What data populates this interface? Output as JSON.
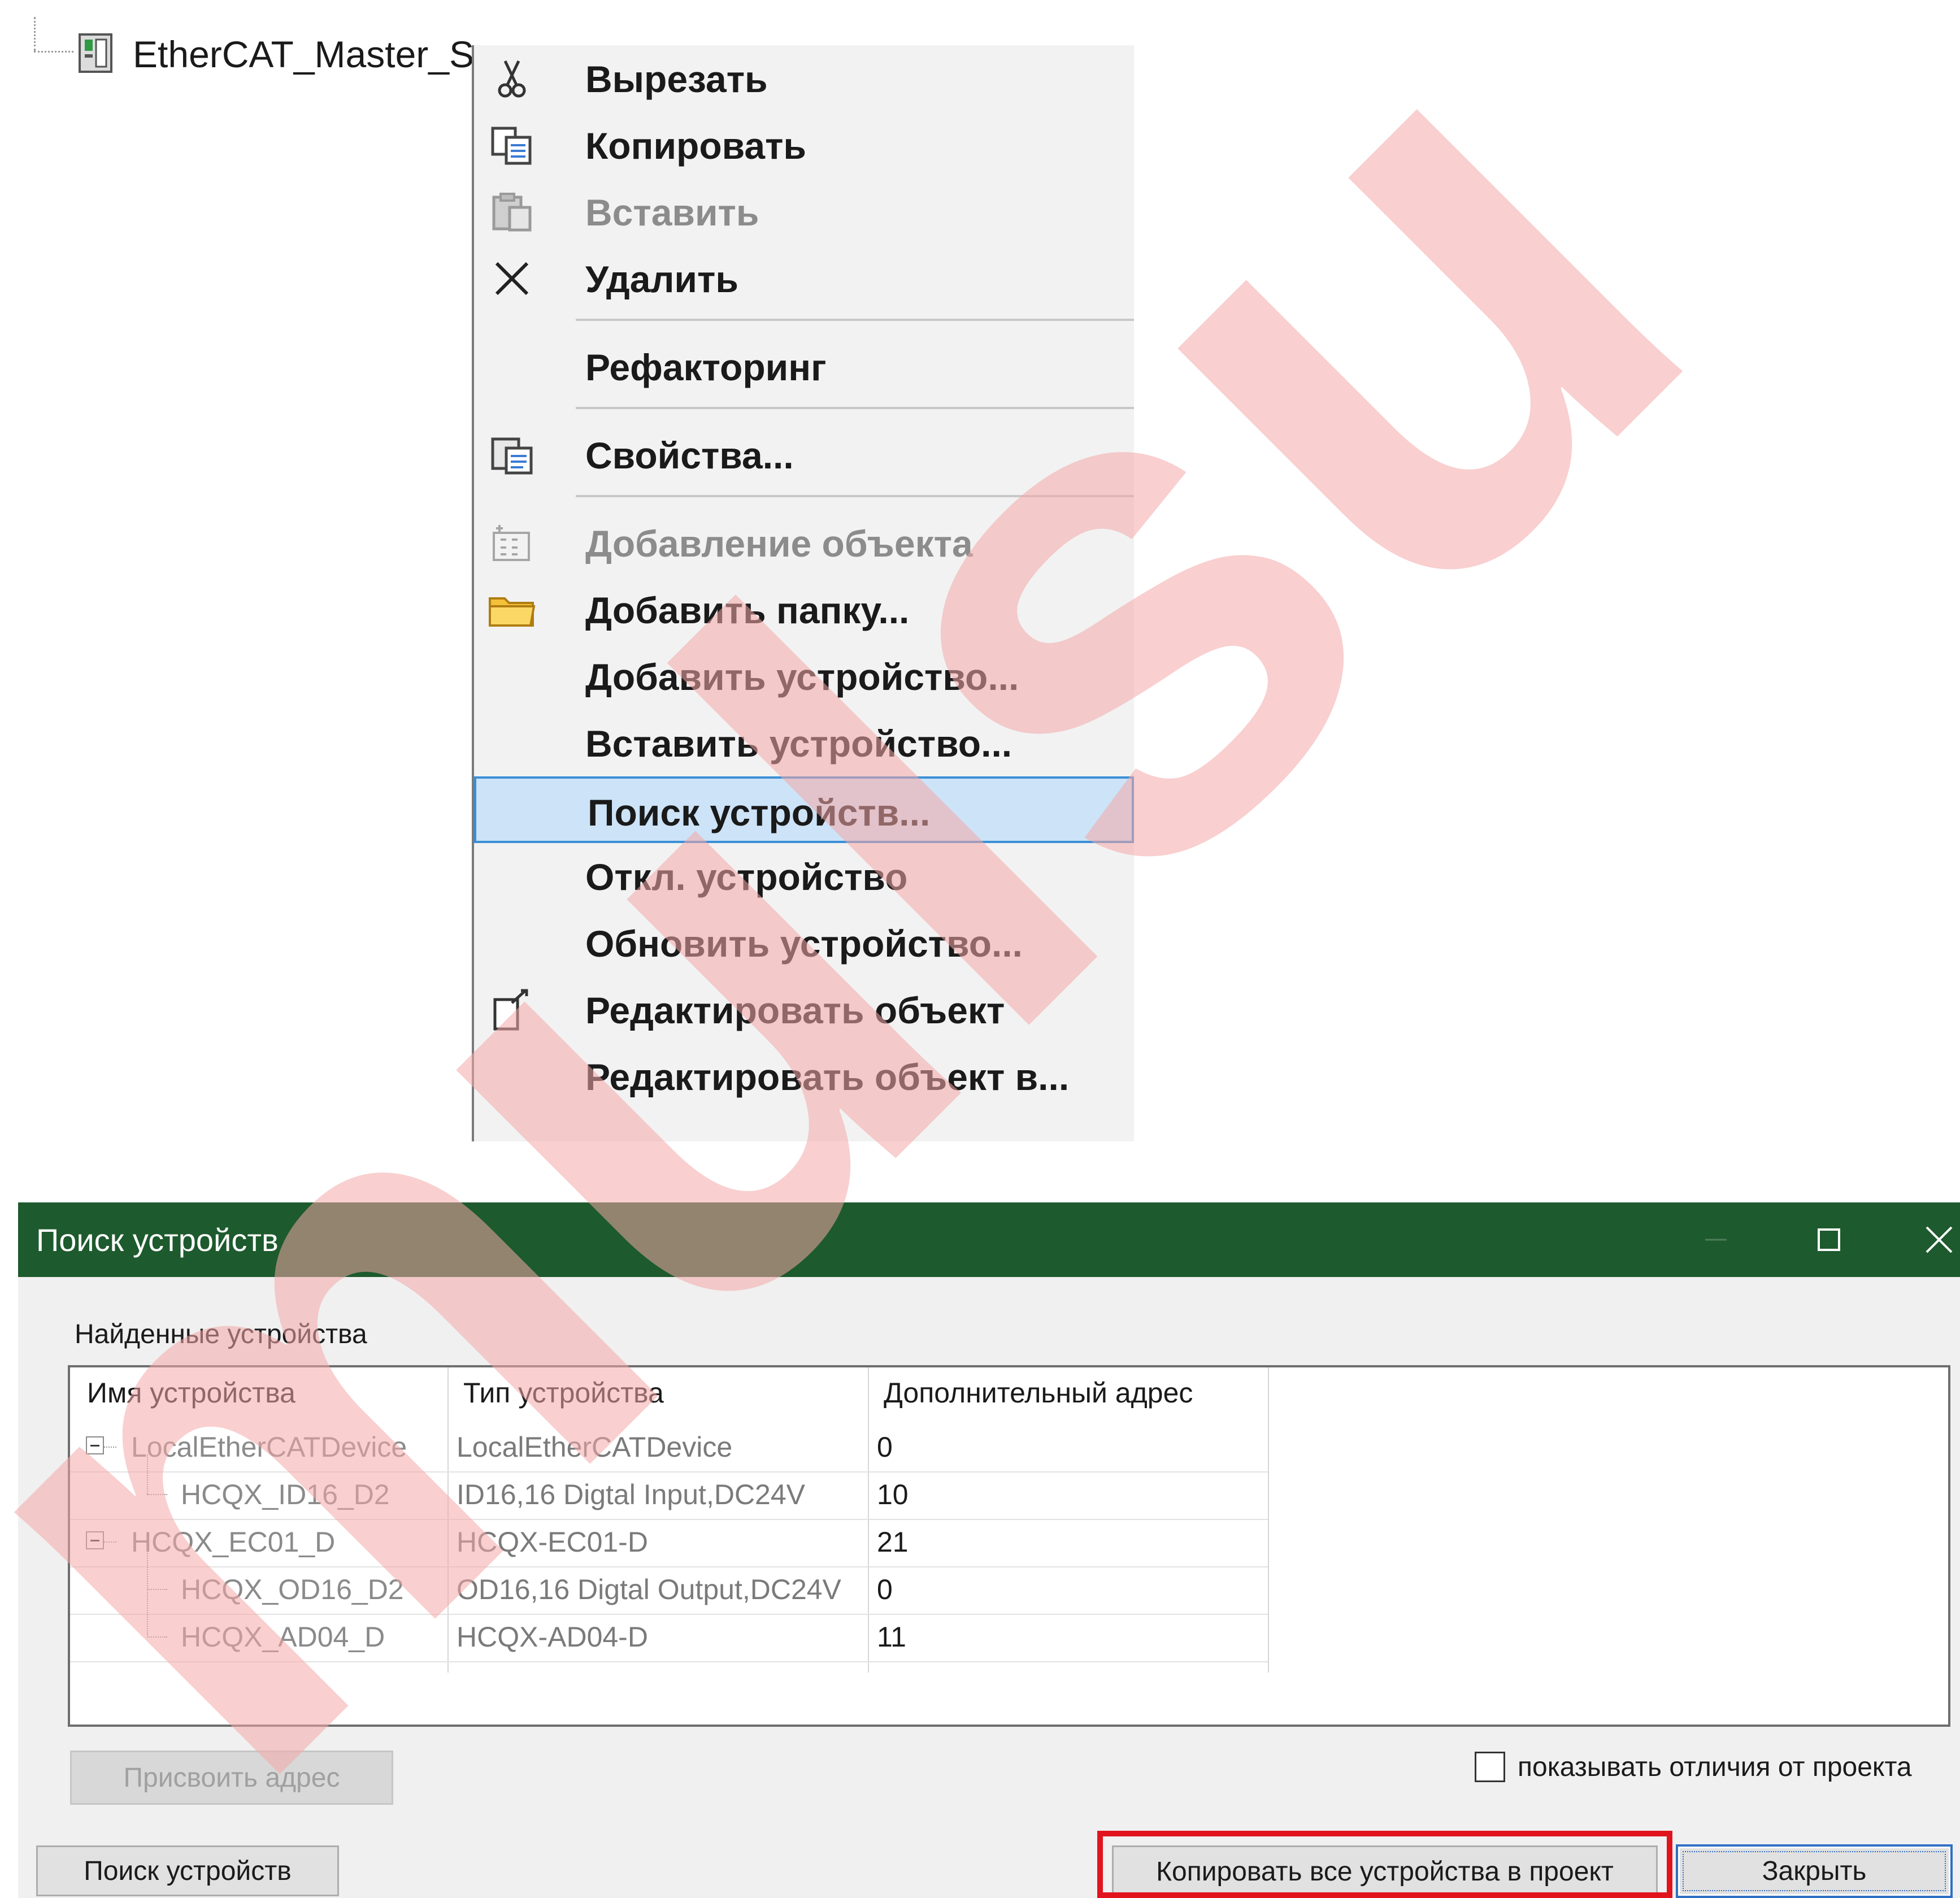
{
  "tree": {
    "node_label": "EtherCAT_Master_So"
  },
  "context_menu": {
    "items": [
      {
        "label": "Вырезать",
        "icon": "scissors-icon",
        "enabled": true
      },
      {
        "label": "Копировать",
        "icon": "copy-icon",
        "enabled": true
      },
      {
        "label": "Вставить",
        "icon": "paste-icon",
        "enabled": false
      },
      {
        "label": "Удалить",
        "icon": "delete-x-icon",
        "enabled": true
      },
      {
        "label": "Рефакторинг",
        "icon": "",
        "enabled": true
      },
      {
        "label": "Свойства...",
        "icon": "properties-icon",
        "enabled": true
      },
      {
        "label": "Добавление объекта",
        "icon": "add-object-icon",
        "enabled": false
      },
      {
        "label": "Добавить папку...",
        "icon": "folder-icon",
        "enabled": true
      },
      {
        "label": "Добавить устройство...",
        "icon": "",
        "enabled": true
      },
      {
        "label": "Вставить устройство...",
        "icon": "",
        "enabled": true
      },
      {
        "label": "Поиск устройств...",
        "icon": "",
        "enabled": true,
        "highlighted": true
      },
      {
        "label": "Откл. устройство",
        "icon": "",
        "enabled": true
      },
      {
        "label": "Обновить устройство...",
        "icon": "",
        "enabled": true
      },
      {
        "label": "Редактировать объект",
        "icon": "edit-object-icon",
        "enabled": true
      },
      {
        "label": "Редактировать объект в...",
        "icon": "",
        "enabled": true
      }
    ]
  },
  "dialog": {
    "title": "Поиск устройств",
    "titlebar_color": "#1d5a2d",
    "group_label": "Найденные устройства",
    "columns": [
      "Имя устройства",
      "Тип устройства",
      "Дополнительный адрес"
    ],
    "rows": [
      {
        "name": "LocalEtherCATDevice",
        "type": "LocalEtherCATDevice",
        "address": "0",
        "level": 0,
        "expandable": true
      },
      {
        "name": "HCQX_ID16_D2",
        "type": "ID16,16 Digtal Input,DC24V",
        "address": "10",
        "level": 1,
        "expandable": false
      },
      {
        "name": "HCQX_EC01_D",
        "type": "HCQX-EC01-D",
        "address": "21",
        "level": 0,
        "expandable": true
      },
      {
        "name": "HCQX_OD16_D2",
        "type": "OD16,16 Digtal Output,DC24V",
        "address": "0",
        "level": 1,
        "expandable": false
      },
      {
        "name": "HCQX_AD04_D",
        "type": "HCQX-AD04-D",
        "address": "11",
        "level": 1,
        "expandable": false
      }
    ],
    "assign_address_label": "Присвоить адрес",
    "show_diff_label": "показывать отличия от проекта",
    "show_diff_checked": false,
    "search_button_label": "Поиск устройств",
    "copy_all_label": "Копировать все устройства в проект",
    "close_label": "Закрыть",
    "highlight_color": "#e1141e"
  },
  "watermark": {
    "text": "mulsu",
    "color": "#f4a8a8"
  }
}
